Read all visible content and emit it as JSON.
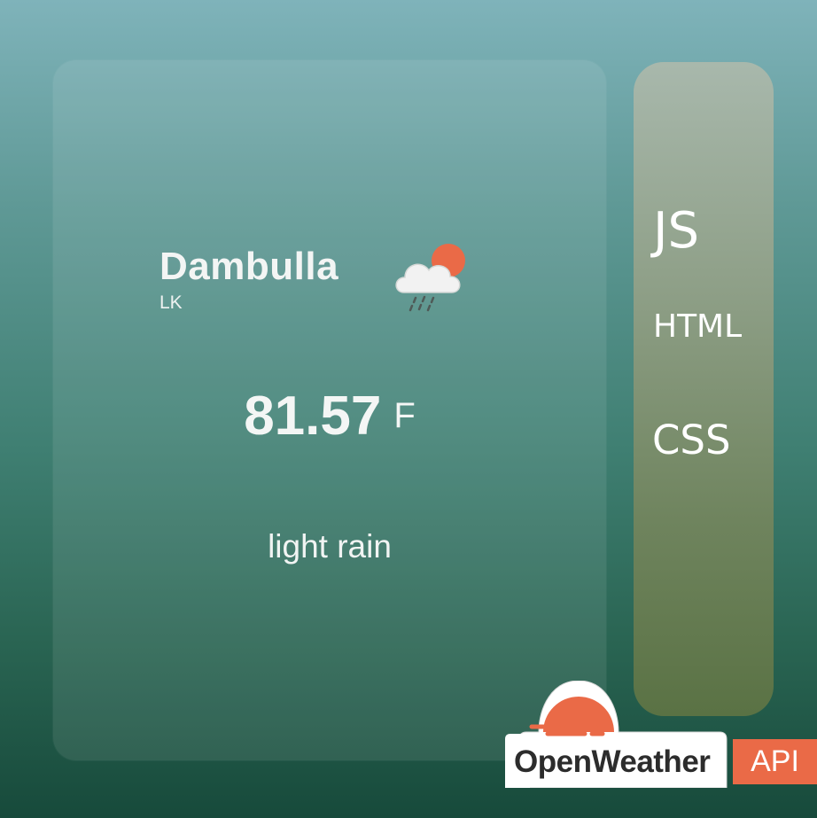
{
  "weather": {
    "city": "Dambulla",
    "country": "LK",
    "temperature": "81.57",
    "unit": "F",
    "description": "light rain",
    "icon": "cloud-sun-rain-icon"
  },
  "tech_stack": {
    "items": [
      "JS",
      "HTML",
      "CSS"
    ]
  },
  "branding": {
    "logo_text": "OpenWeather",
    "api_label": "API",
    "accent_color": "#ea6a47"
  }
}
